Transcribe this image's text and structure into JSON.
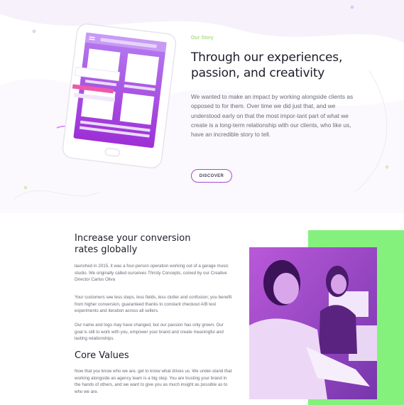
{
  "story": {
    "eyebrow": "Our Story",
    "headline": "Through our experiences, passion, and creativity",
    "body": "We wanted to make an impact by working alongside clients as opposed to for them. Over time we did just that, and we understood early on that the most impor-tant part of what we create is a long-term relationship with our clients, who like us, have an incredible story to tell.",
    "button_label": "DISCOVER"
  },
  "conversion": {
    "heading_line1": "Increase your conversion",
    "heading_line2": "rates globally",
    "para1": " launched in 2015, it was a four-person operation working out of a garage music studio. We originally called ourselves Thirsty Concepts, coined by our Creative Director Carlos Oliva",
    "para2": "Your customers see less steps, less fields, less clutter and confusion; you benefit from higher conversion, guaranteed thanks to constant checkout A/B test experiments and iteration across all sellers.",
    "para3": "Our name and logo may have changed, but our passion has only grown. Our goal is still to work with you, empower your brand and create meaningful and lasting relationships."
  },
  "values": {
    "heading": "Core Values",
    "para": "Now that you know who we are, get to know what drives us. We under-stand that working alongside an agency team is a big step. You are trusting your brand in the hands of others, and we want to give you as much insight as possible as to who we are."
  },
  "colors": {
    "accent_purple": "#a04ad6",
    "accent_green": "#84f17c",
    "eyebrow_green": "#8ccf5a"
  },
  "icons": {
    "illustration": "phone-illustration",
    "photo": "team-photo"
  }
}
